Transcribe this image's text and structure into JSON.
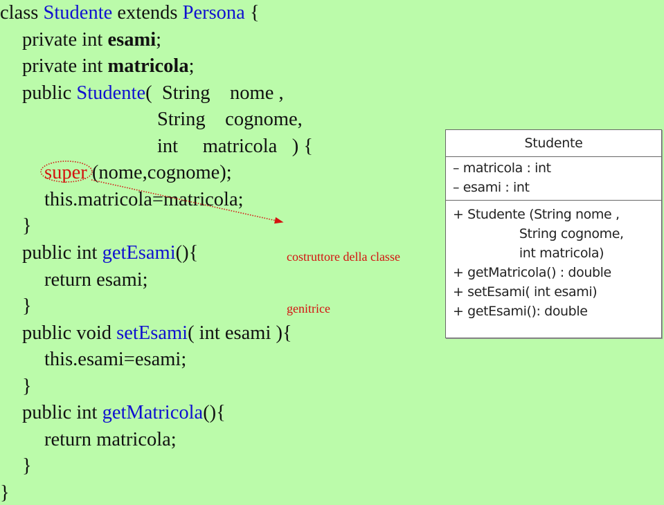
{
  "code": {
    "line1": {
      "a": "class ",
      "b": "Studente",
      "c": " extends ",
      "d": "Persona",
      "e": " {"
    },
    "line2": {
      "a": "private int ",
      "b": "esami",
      "c": ";"
    },
    "line3": {
      "a": "private int ",
      "b": "matricola",
      "c": ";"
    },
    "line4": {
      "a": "public ",
      "b": "Studente",
      "c": "(  String    nome ,"
    },
    "line5": "String    cognome,",
    "line6": "int     matricola   ) {",
    "line7": {
      "a": "super",
      "b": " (nome,cognome);"
    },
    "line8": "this.matricola=matricola;",
    "line9": "}",
    "line10": {
      "a": "public int ",
      "b": "getEsami",
      "c": "(){"
    },
    "line11": "return esami;",
    "line12": "}",
    "line13": {
      "a": "public void ",
      "b": "setEsami",
      "c": "( int esami ){"
    },
    "line14": "this.esami=esami;",
    "line15": "}",
    "line16": {
      "a": "public int ",
      "b": "getMatricola",
      "c": "(){"
    },
    "line17": "return matricola;",
    "line18": "}",
    "line19": "}"
  },
  "annotation": {
    "line1": "costruttore della classe",
    "line2": "genitrice",
    "color": "#d4120f"
  },
  "uml": {
    "title": "Studente",
    "attributes": [
      "– matricola : int",
      "– esami : int"
    ],
    "operations": [
      "+ Studente (String nome ,",
      "                 String cognome,",
      "                 int matricola)",
      "+ getMatricola() : double",
      "+ setEsami( int esami)",
      "+ getEsami(): double"
    ]
  },
  "colors": {
    "background": "#bbfbaa",
    "keyword_blue": "#1010d0",
    "accent_red": "#d4120f"
  }
}
